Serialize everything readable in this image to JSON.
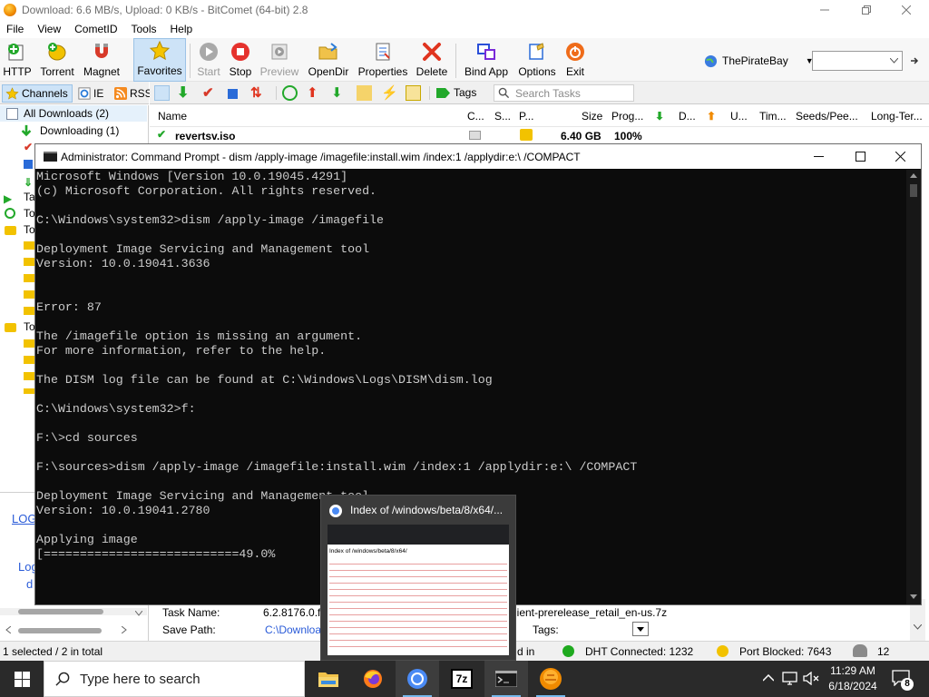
{
  "bitcomet": {
    "title": "Download: 6.6 MB/s, Upload: 0 KB/s - BitComet (64-bit) 2.8",
    "menu": [
      "File",
      "View",
      "CometID",
      "Tools",
      "Help"
    ],
    "toolbar": {
      "http": "HTTP",
      "torrent": "Torrent",
      "magnet": "Magnet",
      "favorites": "Favorites",
      "start": "Start",
      "stop": "Stop",
      "preview": "Preview",
      "opendir": "OpenDir",
      "properties": "Properties",
      "delete": "Delete",
      "bindapp": "Bind App",
      "options": "Options",
      "exit": "Exit",
      "site": "ThePirateBay"
    },
    "sidebar_tabs": {
      "channels": "Channels",
      "ie": "IE",
      "rss": "RSS"
    },
    "sidebar": {
      "all_downloads": "All Downloads (2)",
      "downloading": "Downloading (1)",
      "partial_labels": [
        "Ta",
        "To",
        "To",
        "To"
      ],
      "log_link": "LOG",
      "log_label": "Log",
      "d_label": "d"
    },
    "tasks_toolbar": {
      "tags": "Tags",
      "search_placeholder": "Search Tasks"
    },
    "columns": {
      "name": "Name",
      "c": "C...",
      "s": "S...",
      "p": "P...",
      "size": "Size",
      "progress": "Prog...",
      "d": "D...",
      "u": "U...",
      "time": "Tim...",
      "seeds": "Seeds/Pee...",
      "longterm": "Long-Ter..."
    },
    "task": {
      "name": "revertsv.iso",
      "size": "6.40 GB",
      "progress": "100%"
    },
    "detail": {
      "task_name_label": "Task Name:",
      "task_name_value": "6.2.8176.0.fb",
      "task_name_suffix": "lient-prerelease_retail_en-us.7z",
      "save_path_label": "Save Path:",
      "save_path_value": "C:\\Downloa",
      "tags_label": "Tags:"
    },
    "status": {
      "selected": "1 selected / 2 in total",
      "partial": "d in",
      "dht": "DHT Connected: 1232",
      "port": "Port Blocked: 7643",
      "count": "12"
    },
    "colors": {
      "green": "#1faa1f",
      "red": "#e02a2a",
      "accent": "#2a6bd8"
    }
  },
  "cmd": {
    "title": "Administrator: Command Prompt - dism  /apply-image /imagefile:install.wim /index:1 /applydir:e:\\ /COMPACT",
    "lines": [
      "Microsoft Windows [Version 10.0.19045.4291]",
      "(c) Microsoft Corporation. All rights reserved.",
      "",
      "C:\\Windows\\system32>dism /apply-image /imagefile",
      "",
      "Deployment Image Servicing and Management tool",
      "Version: 10.0.19041.3636",
      "",
      "",
      "Error: 87",
      "",
      "The /imagefile option is missing an argument.",
      "For more information, refer to the help.",
      "",
      "The DISM log file can be found at C:\\Windows\\Logs\\DISM\\dism.log",
      "",
      "C:\\Windows\\system32>f:",
      "",
      "F:\\>cd sources",
      "",
      "F:\\sources>dism /apply-image /imagefile:install.wim /index:1 /applydir:e:\\ /COMPACT",
      "",
      "Deployment Image Servicing and Management tool",
      "Version: 10.0.19041.2780",
      "",
      "Applying image",
      "[===========================49.0%"
    ]
  },
  "thumbnail": {
    "title": "Index of /windows/beta/8/x64/...",
    "page_heading": "Index of /windows/beta/8/x64/"
  },
  "taskbar": {
    "search_placeholder": "Type here to search",
    "time": "11:29 AM",
    "date": "6/18/2024",
    "notification_count": "8",
    "apps": [
      "file-explorer",
      "firefox",
      "chrome",
      "7zip",
      "command-prompt",
      "bitcomet"
    ]
  }
}
